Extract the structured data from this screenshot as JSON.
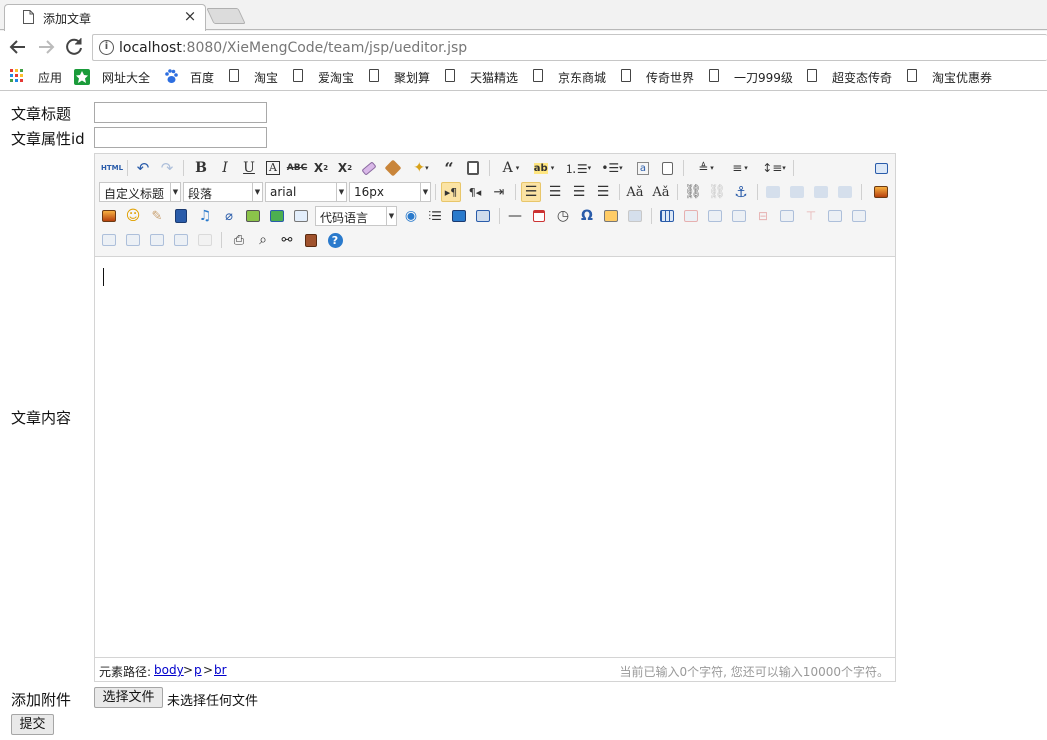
{
  "browser": {
    "tab_title": "添加文章",
    "tab_close": "×",
    "url_host": "localhost",
    "url_rest": ":8080/XieMengCode/team/jsp/ueditor.jsp",
    "bookmarks": [
      "应用",
      "网址大全",
      "百度",
      "淘宝",
      "爱淘宝",
      "聚划算",
      "天猫精选",
      "京东商城",
      "传奇世界",
      "一刀999级",
      "超变态传奇",
      "淘宝优惠券"
    ]
  },
  "form": {
    "title_label": "文章标题",
    "title_value": "",
    "attr_label": "文章属性id",
    "attr_value": "",
    "content_label": "文章内容",
    "attachment_label": "添加附件",
    "file_button": "选择文件",
    "file_status": "未选择任何文件",
    "submit_label": "提交"
  },
  "editor": {
    "html_label": "HTML",
    "custom_heading": "自定义标题",
    "paragraph": "段落",
    "font_family": "arial",
    "font_size": "16px",
    "code_language": "代码语言",
    "path_label": "元素路径:",
    "path": [
      "body",
      "p",
      "br"
    ],
    "path_sep": ">",
    "word_count": "当前已输入0个字符, 您还可以输入10000个字符。"
  },
  "colors": {
    "accent_highlight": "#fbe3a4",
    "link": "#0000cc",
    "toolbar_bg": "#f5f5f5"
  }
}
